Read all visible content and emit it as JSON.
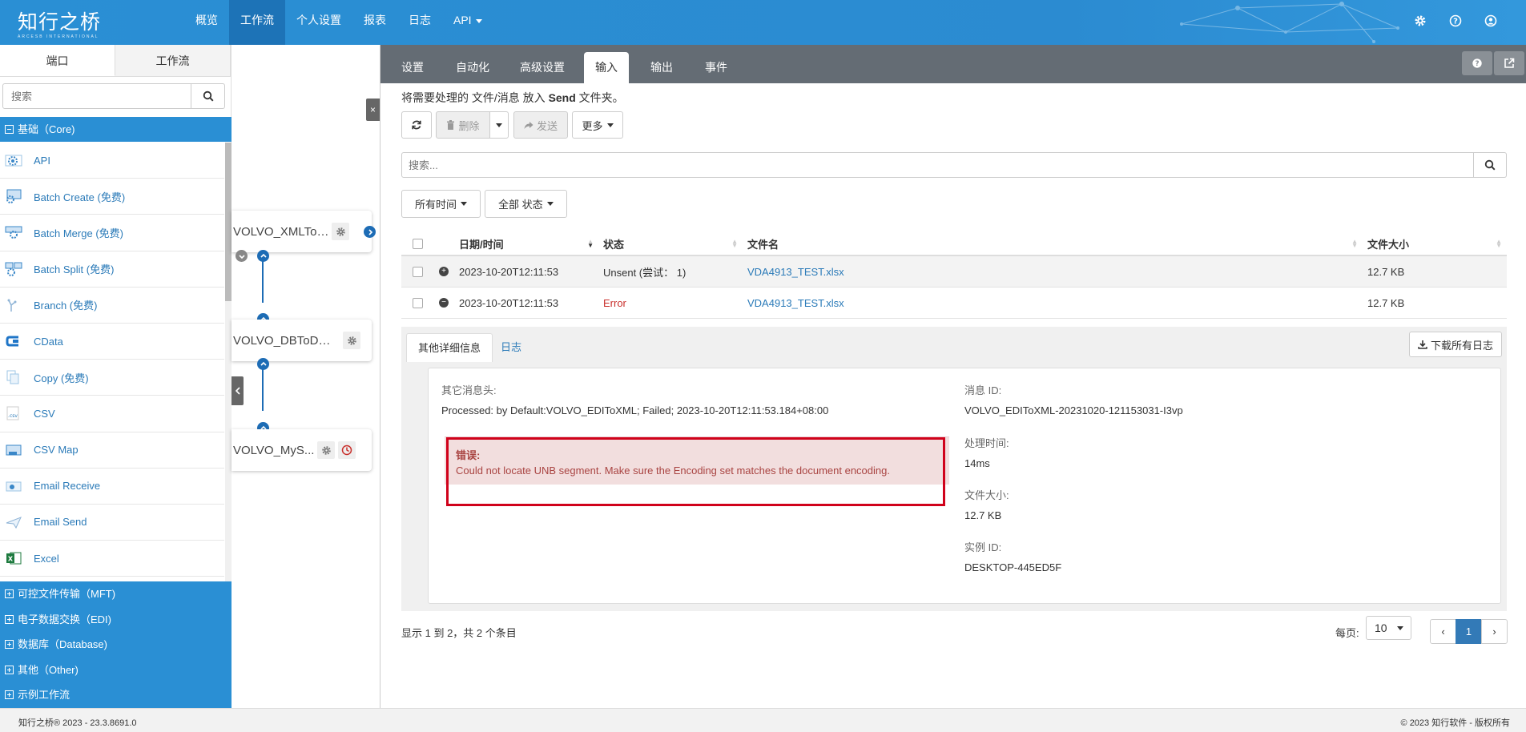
{
  "app": {
    "logo_text": "知行之桥",
    "logo_subtext": "ARCESB INTERNATIONAL"
  },
  "nav": {
    "items": [
      "概览",
      "工作流",
      "个人设置",
      "报表",
      "日志",
      "API"
    ],
    "active": "工作流"
  },
  "sidebar": {
    "tabs": [
      "端口",
      "工作流"
    ],
    "search_placeholder": "搜索",
    "core_category": "基础（Core)",
    "core_items": [
      {
        "label": "API",
        "icon": "api-icon"
      },
      {
        "label": "Batch Create (免费)",
        "icon": "batch-create-icon"
      },
      {
        "label": "Batch Merge (免费)",
        "icon": "batch-merge-icon"
      },
      {
        "label": "Batch Split (免费)",
        "icon": "batch-split-icon"
      },
      {
        "label": "Branch (免费)",
        "icon": "branch-icon"
      },
      {
        "label": "CData",
        "icon": "cdata-icon"
      },
      {
        "label": "Copy (免费)",
        "icon": "copy-icon"
      },
      {
        "label": "CSV",
        "icon": "csv-icon"
      },
      {
        "label": "CSV Map",
        "icon": "csv-map-icon"
      },
      {
        "label": "Email Receive",
        "icon": "email-receive-icon"
      },
      {
        "label": "Email Send",
        "icon": "email-send-icon"
      },
      {
        "label": "Excel",
        "icon": "excel-icon"
      }
    ],
    "other_categories": [
      "可控文件传输（MFT)",
      "电子数据交换（EDI)",
      "数据库（Database)",
      "其他（Other)",
      "示例工作流"
    ]
  },
  "canvas": {
    "nodes": [
      "VOLVO_XMLToEDI",
      "VOLVO_DBToDE...",
      "VOLVO_MyS..."
    ],
    "collapse_glyph": "×"
  },
  "main": {
    "tabs": [
      "设置",
      "自动化",
      "高级设置",
      "输入",
      "输出",
      "事件"
    ],
    "active_tab": "输入",
    "info_prefix": "将需要处理的 文件/消息 放入 ",
    "info_folder": "Send",
    "info_suffix": " 文件夹。",
    "toolbar": {
      "delete": "删除",
      "send": "发送",
      "more": "更多"
    },
    "search_placeholder": "搜索...",
    "filters": [
      "所有时间",
      "全部 状态"
    ],
    "table": {
      "headers": [
        "日期/时间",
        "状态",
        "文件名",
        "文件大小"
      ],
      "rows": [
        {
          "datetime": "2023-10-20T12:11:53",
          "status": "Unsent (尝试： 1)",
          "filename": "VDA4913_TEST.xlsx",
          "size": "12.7 KB",
          "expander": "+",
          "status_type": "normal"
        },
        {
          "datetime": "2023-10-20T12:11:53",
          "status": "Error",
          "filename": "VDA4913_TEST.xlsx",
          "size": "12.7 KB",
          "expander": "−",
          "status_type": "error"
        }
      ]
    },
    "detail": {
      "tabs": [
        "其他详细信息",
        "日志"
      ],
      "download_label": "下载所有日志",
      "other_headers_label": "其它消息头:",
      "other_headers_value": "Processed: by Default:VOLVO_EDIToXML; Failed; 2023-10-20T12:11:53.184+08:00",
      "error_label": "错误:",
      "error_text": "Could not locate UNB segment. Make sure the Encoding set matches the document encoding.",
      "message_id_label": "消息 ID:",
      "message_id": "VOLVO_EDIToXML-20231020-121153031-I3vp",
      "processing_time_label": "处理时间:",
      "processing_time": "14ms",
      "file_size_label": "文件大小:",
      "file_size": "12.7 KB",
      "instance_id_label": "实例 ID:",
      "instance_id": "DESKTOP-445ED5F"
    },
    "pagination": {
      "info": "显示 1 到 2，共 2 个条目",
      "per_page_label": "每页:",
      "per_page": "10",
      "current_page": "1",
      "prev": "‹",
      "next": "›"
    }
  },
  "footer": {
    "left": "知行之桥® 2023 - 23.3.8691.0",
    "right": "© 2023 知行软件 - 版权所有"
  },
  "colors": {
    "brand": "#2a8fd4",
    "nav_active": "#1d73b7",
    "tab_bar": "#646c74",
    "error": "#c9302c",
    "highlight_frame": "#d0021b"
  }
}
